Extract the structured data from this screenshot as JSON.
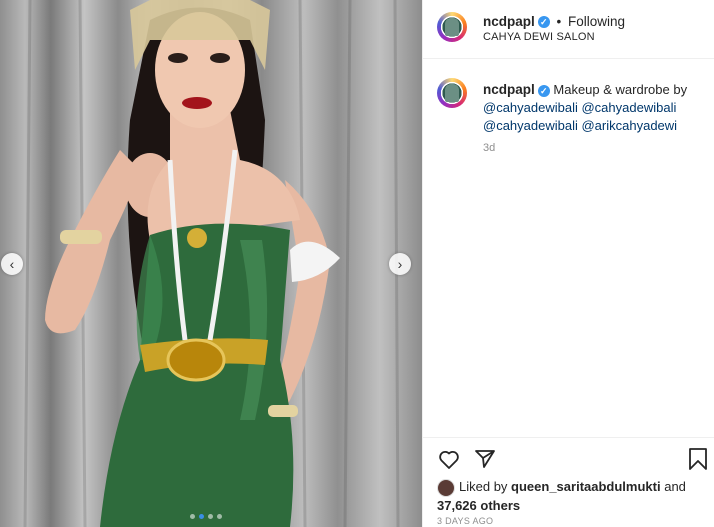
{
  "header": {
    "username": "ncdpapl",
    "verified_glyph": "✓",
    "separator": "•",
    "follow_label": "Following",
    "location": "CAHYA DEWI SALON"
  },
  "caption": {
    "username": "ncdpapl",
    "text": "Makeup & wardrobe by",
    "mentions": [
      "@cahyadewibali",
      "@cahyadewibali",
      "@cahyadewibali",
      "@arikcahyadewi"
    ],
    "relative_time": "3d"
  },
  "media": {
    "prev_glyph": "‹",
    "next_glyph": "›",
    "carousel_count": 4,
    "carousel_active": 1
  },
  "actions": {
    "like_icon": "heart-icon",
    "share_icon": "paper-plane-icon",
    "save_icon": "bookmark-icon"
  },
  "likes": {
    "prefix": "Liked by",
    "user": "queen_saritaabdulmukti",
    "and": "and",
    "others": "37,626 others"
  },
  "timestamp": "3 DAYS AGO",
  "colors": {
    "verified": "#3897f0",
    "link": "#00376b",
    "muted": "#8e8e8e",
    "dress": "#2e6b3c",
    "gold": "#c9a227"
  }
}
